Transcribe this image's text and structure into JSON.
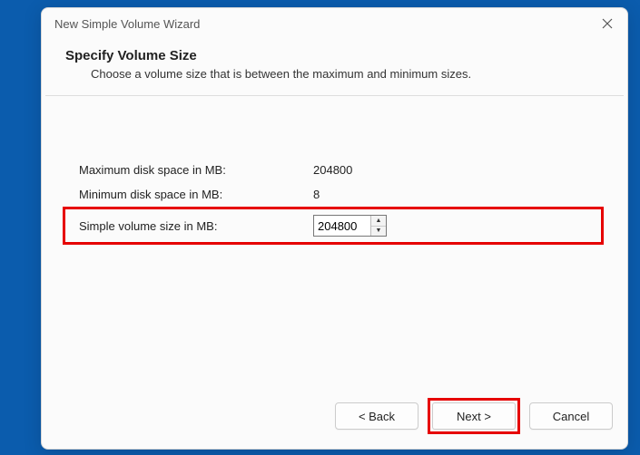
{
  "window": {
    "title": "New Simple Volume Wizard"
  },
  "header": {
    "heading": "Specify Volume Size",
    "sub": "Choose a volume size that is between the maximum and minimum sizes."
  },
  "fields": {
    "max_label": "Maximum disk space in MB:",
    "max_value": "204800",
    "min_label": "Minimum disk space in MB:",
    "min_value": "8",
    "size_label": "Simple volume size in MB:",
    "size_value": "204800"
  },
  "buttons": {
    "back": "< Back",
    "next": "Next >",
    "cancel": "Cancel"
  }
}
